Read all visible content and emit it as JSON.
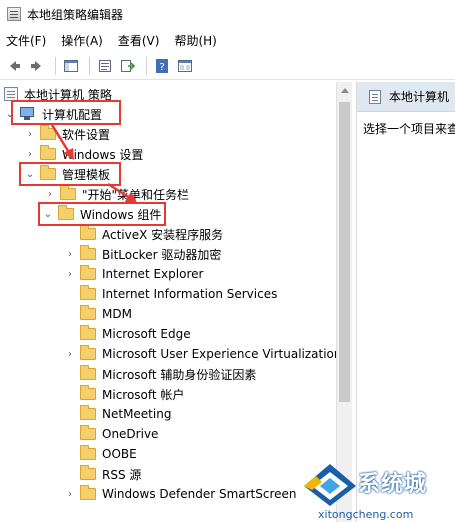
{
  "window": {
    "title": "本地组策略编辑器"
  },
  "menu": {
    "items": [
      "文件(F)",
      "操作(A)",
      "查看(V)",
      "帮助(H)"
    ]
  },
  "toolbar": {
    "icons": [
      "back-arrow-icon",
      "forward-arrow-icon",
      "show-hide-tree-icon",
      "properties-icon",
      "export-list-icon",
      "help-icon",
      "view-icon"
    ]
  },
  "tree": {
    "root": "本地计算机 策略",
    "computer_config": "计算机配置",
    "software_settings": "软件设置",
    "windows_settings": "Windows 设置",
    "admin_templates": "管理模板",
    "start_menu": "\"开始\"菜单和任务栏",
    "windows_components": "Windows 组件",
    "components": [
      "ActiveX 安装程序服务",
      "BitLocker 驱动器加密",
      "Internet Explorer",
      "Internet Information Services",
      "MDM",
      "Microsoft Edge",
      "Microsoft User Experience Virtualization",
      "Microsoft 辅助身份验证因素",
      "Microsoft 帐户",
      "NetMeeting",
      "OneDrive",
      "OOBE",
      "RSS 源",
      "Windows Defender SmartScreen"
    ],
    "component_expandable": [
      false,
      true,
      true,
      false,
      false,
      false,
      true,
      false,
      false,
      false,
      false,
      false,
      false,
      true
    ]
  },
  "right_pane": {
    "header": "本地计算机",
    "description": "选择一个项目来查"
  },
  "watermark": {
    "text": "系统城",
    "url": "xitongcheng.com"
  },
  "colors": {
    "highlight": "#e53935",
    "folder": "#f5cf6b",
    "header_bg": "#dfe7f1"
  }
}
